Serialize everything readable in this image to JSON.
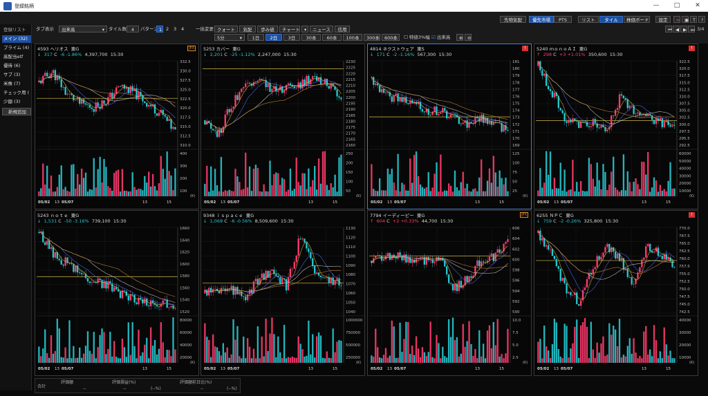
{
  "title": "登録銘柄",
  "window_controls": [
    "—",
    "□",
    "✕"
  ],
  "toolbar": {
    "tab_display": "タブ表示",
    "sort_value": "出来高",
    "tile_count_label": "タイル数",
    "tile_count": "4",
    "pattern_label": "パターン",
    "patterns": [
      "1",
      "2",
      "3",
      "4"
    ],
    "batch_change": "一括変更",
    "btn_quote": "クォート",
    "btn_board": "気配",
    "btn_step": "歩み値",
    "btn_chart": "チャート",
    "btn_news": "ニュース",
    "btn_credit": "信用",
    "interval": "5分",
    "periods": [
      "1日",
      "2日",
      "3日",
      "30本",
      "60本",
      "100本",
      "300本",
      "600本"
    ],
    "opt_3pct": "特値3%幅",
    "opt_volume": "出来高",
    "btn_priority": "先物気配",
    "btn_priority_market": "優先市場",
    "btn_pts": "PTS",
    "btn_list": "リスト",
    "btn_tile": "タイル",
    "btn_board2": "株価ボード",
    "btn_settings": "設定",
    "page": "3/4"
  },
  "sidebar": [
    "登録リスト",
    "メイン (32)",
    "プライム (4)",
    "高配当etf",
    "優待 (6)",
    "サブ (3)",
    "米株 (7)",
    "チェック用 (",
    "少額 (3)",
    "新規追加"
  ],
  "colors": {
    "up": "#ff3b6e",
    "down": "#27c8d0",
    "ma1": "#d9c24a",
    "ma2": "#5b6cff",
    "ma3": "#cfcfcf",
    "ma4": "#d08a3a",
    "ref": "#b8a240"
  },
  "tiles": [
    {
      "code": "4593",
      "name": "ヘリオス",
      "market": "東G",
      "price": "317",
      "unit": "C",
      "change": "-6",
      "pct": "-1.86%",
      "volume": "4,397,700",
      "time": "15:30",
      "dir": "down",
      "badge": "jp",
      "ylabels": [
        "332.5",
        "330.0",
        "327.5",
        "325.0",
        "322.5",
        "320.0",
        "317.5",
        "315.0",
        "312.5",
        "310.0"
      ],
      "vlabels": [
        "400",
        "300",
        "200",
        "100"
      ],
      "xlabels": [
        "05/02",
        "13",
        "05/07",
        "13",
        "15"
      ],
      "ylim": [
        309,
        333
      ],
      "ref": 322.5,
      "seed": 11,
      "trend": [
        327,
        330,
        324,
        321,
        320,
        322,
        326,
        324,
        321,
        318,
        313
      ],
      "vmax": 420
    },
    {
      "code": "5253",
      "name": "カバー",
      "market": "東G",
      "price": "2,201",
      "unit": "C",
      "change": "-25",
      "pct": "-1.12%",
      "volume": "2,247,000",
      "time": "15:30",
      "dir": "down",
      "badge": "",
      "ylabels": [
        "2230",
        "2225",
        "2220",
        "2215",
        "2210",
        "2205",
        "2200",
        "2195",
        "2190",
        "2185",
        "2180",
        "2175",
        "2170",
        "2165",
        "2160"
      ],
      "vlabels": [
        "250",
        "200",
        "150",
        "100",
        "50"
      ],
      "xlabels": [
        "05/02",
        "13",
        "05/07",
        "13",
        "15"
      ],
      "ylim": [
        2157,
        2232
      ],
      "ref": 2225,
      "seed": 22,
      "trend": [
        2180,
        2168,
        2195,
        2208,
        2218,
        2205,
        2210,
        2212,
        2218,
        2212,
        2202
      ],
      "vmax": 270
    },
    {
      "code": "4814",
      "name": "ネクストウェア",
      "market": "東S",
      "price": "171",
      "unit": "C",
      "change": "-2",
      "pct": "-1.16%",
      "volume": "567,300",
      "time": "15:30",
      "dir": "down",
      "badge": "warn",
      "ylabels": [
        "181",
        "180",
        "179",
        "178",
        "177",
        "176",
        "175",
        "174",
        "173",
        "172",
        "171",
        "170",
        "169"
      ],
      "vlabels": [
        "125",
        "100",
        "75",
        "50",
        "25"
      ],
      "xlabels": [
        "05/02",
        "13",
        "05/07",
        "13",
        "15"
      ],
      "ylim": [
        168.5,
        181.5
      ],
      "ref": 173,
      "seed": 33,
      "trend": [
        179,
        176,
        176,
        175,
        174,
        174,
        173,
        172,
        173,
        172,
        171
      ],
      "vmax": 130
    },
    {
      "code": "5240",
      "name": "ｍｏｎｏＡＩ",
      "market": "東G",
      "price": "298",
      "unit": "C",
      "change": "+3",
      "pct": "+1.01%",
      "volume": "350,600",
      "time": "15:30",
      "dir": "up",
      "badge": "warn",
      "ylabels": [
        "322.5",
        "320.0",
        "317.5",
        "315.0",
        "312.5",
        "310.0",
        "307.5",
        "305.0",
        "302.5",
        "300.0",
        "297.5",
        "295.5",
        "292.5"
      ],
      "vlabels": [
        "60000",
        "50000",
        "40000",
        "30000",
        "20000",
        "10000"
      ],
      "xlabels": [
        "05/02",
        "13",
        "05/07",
        "13",
        "15"
      ],
      "ylim": [
        291,
        324
      ],
      "ref": 301,
      "seed": 44,
      "trend": [
        322,
        312,
        302,
        300,
        300,
        296,
        310,
        305,
        302,
        300,
        298
      ],
      "vmax": 64000
    },
    {
      "code": "5243",
      "name": "ｎｏｔｅ",
      "market": "東G",
      "price": "1,531",
      "unit": "C",
      "change": "-50",
      "pct": "-3.16%",
      "volume": "739,100",
      "time": "15:30",
      "dir": "down",
      "badge": "",
      "ylabels": [
        "1660",
        "1640",
        "1620",
        "1600",
        "1580",
        "1560",
        "1540",
        "1520"
      ],
      "vlabels": [
        "80000",
        "60000",
        "40000",
        "20000"
      ],
      "xlabels": [
        "05/02",
        "13",
        "05/07",
        "13",
        "15"
      ],
      "ylim": [
        1515,
        1668
      ],
      "ref": 1580,
      "seed": 55,
      "trend": [
        1660,
        1620,
        1605,
        1585,
        1575,
        1565,
        1550,
        1540,
        1535,
        1535,
        1531
      ],
      "vmax": 85000
    },
    {
      "code": "9348",
      "name": "ｉｓｐａｃｅ",
      "market": "東G",
      "price": "1,068",
      "unit": "C",
      "change": "-6",
      "pct": "-0.56%",
      "volume": "8,509,600",
      "time": "15:30",
      "dir": "down",
      "badge": "",
      "ylabels": [
        "1130",
        "1120",
        "1110",
        "1100",
        "1090",
        "1080",
        "1070",
        "1060",
        "1050",
        "1040"
      ],
      "vlabels": [
        "1000000",
        "750000",
        "500000",
        "250000"
      ],
      "xlabels": [
        "05/02",
        "13",
        "05/07",
        "13",
        "15"
      ],
      "ylim": [
        1035,
        1135
      ],
      "ref": 1070,
      "seed": 66,
      "trend": [
        1058,
        1060,
        1062,
        1055,
        1075,
        1085,
        1065,
        1125,
        1085,
        1075,
        1068
      ],
      "vmax": 1100000
    },
    {
      "code": "7794",
      "name": "イーディーピー",
      "market": "東G",
      "price": "604",
      "unit": "C",
      "change": "+2",
      "pct": "+0.33%",
      "volume": "44,700",
      "time": "15:30",
      "dir": "up",
      "badge": "jp",
      "ylabels": [
        "606",
        "604",
        "602",
        "600",
        "598",
        "596",
        "594",
        "592",
        "590"
      ],
      "vlabels": [
        "10.0",
        "7.5",
        "5.0",
        "2.5"
      ],
      "xlabels": [
        "05/02",
        "13",
        "05/07",
        "13",
        "15"
      ],
      "ylim": [
        589,
        607
      ],
      "ref": 601,
      "seed": 77,
      "trend": [
        600,
        601,
        601,
        600,
        600,
        601,
        594,
        596,
        600,
        601,
        604
      ],
      "vmax": 10.5
    },
    {
      "code": "6255",
      "name": "ＮＰＣ",
      "market": "東G",
      "price": "759",
      "unit": "C",
      "change": "-2",
      "pct": "-0.26%",
      "volume": "325,800",
      "time": "15:30",
      "dir": "down",
      "badge": "warn",
      "ylabels": [
        "770.0",
        "767.5",
        "765.0",
        "762.5",
        "760.0",
        "757.5",
        "755.0",
        "752.5",
        "750.0",
        "747.5",
        "745.0",
        "742.5"
      ],
      "vlabels": [
        "40000",
        "30000",
        "20000",
        "10000"
      ],
      "xlabels": [
        "05/02",
        "13",
        "05/07",
        "13",
        "15"
      ],
      "ylim": [
        741,
        772
      ],
      "ref": 760,
      "seed": 88,
      "trend": [
        770,
        762,
        750,
        745,
        758,
        765,
        760,
        752,
        766,
        762,
        759
      ],
      "vmax": 42000
    }
  ],
  "bottom": {
    "total": "合計",
    "col1": "評価額",
    "col2": "評価損益(%)",
    "col3": "評価額前日比(%)",
    "v1": "--",
    "v2": "--",
    "v2b": "(--%)",
    "v3": "--",
    "v3b": "(--%)"
  }
}
